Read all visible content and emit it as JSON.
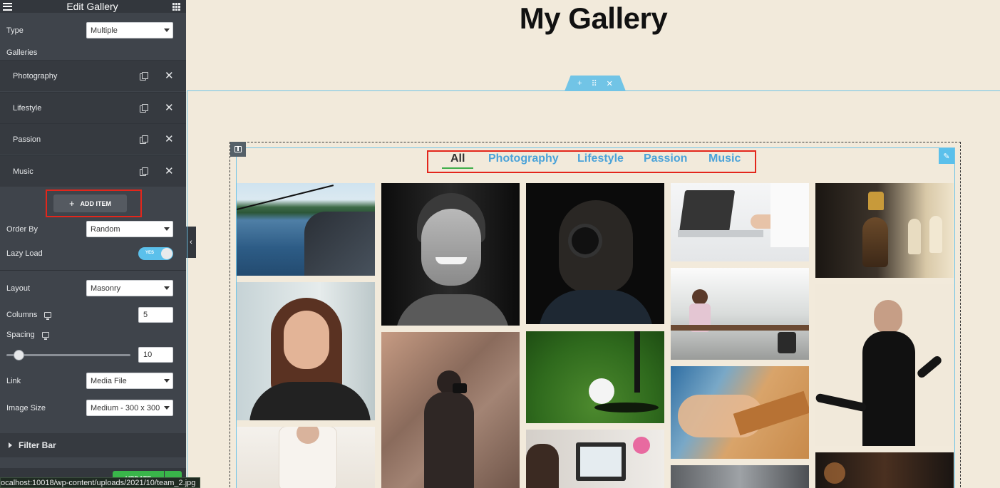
{
  "sidebar": {
    "title": "Edit Gallery",
    "type_label": "Type",
    "type_value": "Multiple",
    "galleries_label": "Galleries",
    "galleries": [
      {
        "name": "Photography"
      },
      {
        "name": "Lifestyle"
      },
      {
        "name": "Passion"
      },
      {
        "name": "Music"
      }
    ],
    "add_item_label": "ADD ITEM",
    "order_by_label": "Order By",
    "order_by_value": "Random",
    "lazy_load_label": "Lazy Load",
    "lazy_load_value": "YES",
    "layout_label": "Layout",
    "layout_value": "Masonry",
    "columns_label": "Columns",
    "columns_value": "5",
    "spacing_label": "Spacing",
    "spacing_value": "10",
    "link_label": "Link",
    "link_value": "Media File",
    "image_size_label": "Image Size",
    "image_size_value": "Medium - 300 x 300",
    "filter_bar_label": "Filter Bar",
    "update_label": "UPDATE"
  },
  "canvas": {
    "page_title": "My Gallery",
    "filter_tabs": [
      {
        "label": "All",
        "active": true
      },
      {
        "label": "Photography",
        "active": false
      },
      {
        "label": "Lifestyle",
        "active": false
      },
      {
        "label": "Passion",
        "active": false
      },
      {
        "label": "Music",
        "active": false
      }
    ]
  },
  "status_bar": {
    "url": "ocalhost:10018/wp-content/uploads/2021/10/team_2.jpg"
  },
  "colors": {
    "accent_blue": "#4ba3d9",
    "highlight_red": "#e3261b",
    "active_underline": "#3fae49",
    "canvas_bg": "#f2eadb",
    "panel_bg": "#3f444b"
  }
}
